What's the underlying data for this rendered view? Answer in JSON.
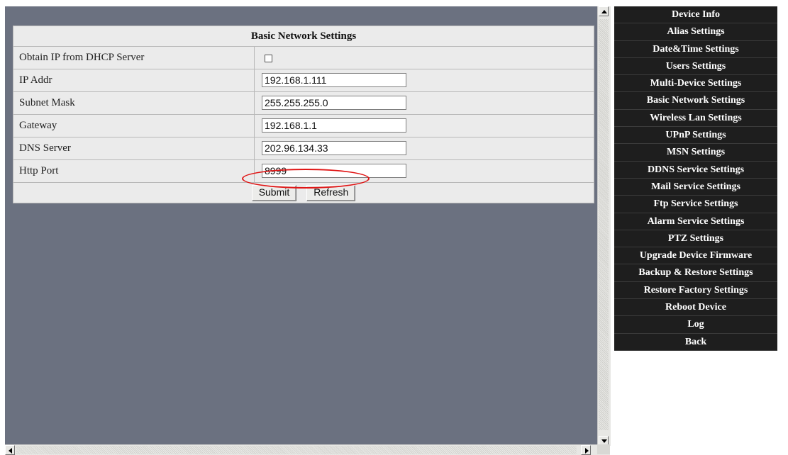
{
  "panel": {
    "title": "Basic Network Settings",
    "dhcp_label": "Obtain IP from DHCP Server",
    "dhcp_checked": false,
    "ip_label": "IP Addr",
    "ip_value": "192.168.1.111",
    "mask_label": "Subnet Mask",
    "mask_value": "255.255.255.0",
    "gateway_label": "Gateway",
    "gateway_value": "192.168.1.1",
    "dns_label": "DNS Server",
    "dns_value": "202.96.134.33",
    "port_label": "Http Port",
    "port_value": "8999",
    "submit_label": "Submit",
    "refresh_label": "Refresh"
  },
  "menu": {
    "items": [
      "Device Info",
      "Alias Settings",
      "Date&Time Settings",
      "Users Settings",
      "Multi-Device Settings",
      "Basic Network Settings",
      "Wireless Lan Settings",
      "UPnP Settings",
      "MSN Settings",
      "DDNS Service Settings",
      "Mail Service Settings",
      "Ftp Service Settings",
      "Alarm Service Settings",
      "PTZ Settings",
      "Upgrade Device Firmware",
      "Backup & Restore Settings",
      "Restore Factory Settings",
      "Reboot Device",
      "Log",
      "Back"
    ]
  },
  "colors": {
    "frame_bg": "#6b7180",
    "menu_bg": "#1e1e1e",
    "panel_bg": "#ebebeb",
    "highlight": "#e01515"
  },
  "icons": [
    "scroll-up-icon",
    "scroll-down-icon",
    "scroll-left-icon",
    "scroll-right-icon",
    "checkbox-icon"
  ]
}
